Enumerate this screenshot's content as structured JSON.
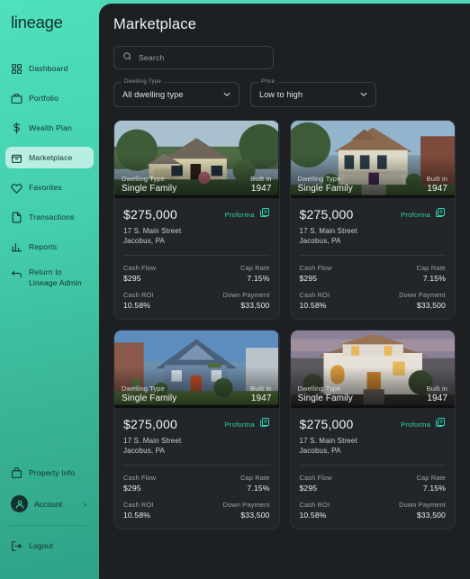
{
  "brand": {
    "logo_text": "lineage",
    "accent_color": "#4ed8b5",
    "proforma_color": "#2fd3ab"
  },
  "sidebar": {
    "items": [
      {
        "label": "Dashboard",
        "icon": "dashboard-icon",
        "active": false
      },
      {
        "label": "Portfolio",
        "icon": "briefcase-icon",
        "active": false
      },
      {
        "label": "Wealth Plan",
        "icon": "dollar-icon",
        "active": false
      },
      {
        "label": "Marketplace",
        "icon": "store-icon",
        "active": true
      },
      {
        "label": "Favorites",
        "icon": "heart-icon",
        "active": false
      },
      {
        "label": "Transactions",
        "icon": "document-icon",
        "active": false
      },
      {
        "label": "Reports",
        "icon": "bar-chart-icon",
        "active": false
      }
    ],
    "return_link": {
      "line1": "Return to",
      "line2": "Lineage Admin",
      "icon": "arrow-left-icon"
    },
    "bottom": {
      "property_info": {
        "label": "Property Info",
        "icon": "info-bag-icon"
      },
      "account": {
        "label": "Account",
        "icon": "avatar-icon",
        "chevron": "›"
      },
      "logout": {
        "label": "Logout",
        "icon": "logout-icon"
      }
    }
  },
  "header": {
    "title": "Marketplace"
  },
  "search": {
    "placeholder": "Search",
    "value": "",
    "icon": "search-icon"
  },
  "filters": [
    {
      "label": "Dwelling Type",
      "value": "All dwelling type",
      "name": "dwelling-type-select"
    },
    {
      "label": "Price",
      "value": "Low to high",
      "name": "price-sort-select"
    }
  ],
  "card_labels": {
    "dwelling_type": "Dwelling Type",
    "built_in": "Built in",
    "proforma": "Proforma",
    "cash_flow": "Cash Flow",
    "cap_rate": "Cap Rate",
    "cash_roi": "Cash ROI",
    "down_payment": "Down Payment"
  },
  "listings": [
    {
      "dwelling_type": "Single Family",
      "built_in": "1947",
      "price": "$275,000",
      "address_line1": "17 S. Main Street",
      "address_line2": "Jacobus, PA",
      "cash_flow": "$295",
      "cap_rate": "7.15%",
      "cash_roi": "10.58%",
      "down_payment": "$33,500",
      "photo": "cream-cottage-with-garage"
    },
    {
      "dwelling_type": "Single Family",
      "built_in": "1947",
      "price": "$275,000",
      "address_line1": "17 S. Main Street",
      "address_line2": "Jacobus, PA",
      "cash_flow": "$295",
      "cap_rate": "7.15%",
      "cash_roi": "10.58%",
      "down_payment": "$33,500",
      "photo": "victorian-two-story-porch"
    },
    {
      "dwelling_type": "Single Family",
      "built_in": "1947",
      "price": "$275,000",
      "address_line1": "17 S. Main Street",
      "address_line2": "Jacobus, PA",
      "cash_flow": "$295",
      "cap_rate": "7.15%",
      "cash_roi": "10.58%",
      "down_payment": "$33,500",
      "photo": "blue-gable-house-red-door"
    },
    {
      "dwelling_type": "Single Family",
      "built_in": "1947",
      "price": "$275,000",
      "address_line1": "17 S. Main Street",
      "address_line2": "Jacobus, PA",
      "cash_flow": "$295",
      "cap_rate": "7.15%",
      "cash_roi": "10.58%",
      "down_payment": "$33,500",
      "photo": "white-spanish-villa-dusk"
    }
  ]
}
